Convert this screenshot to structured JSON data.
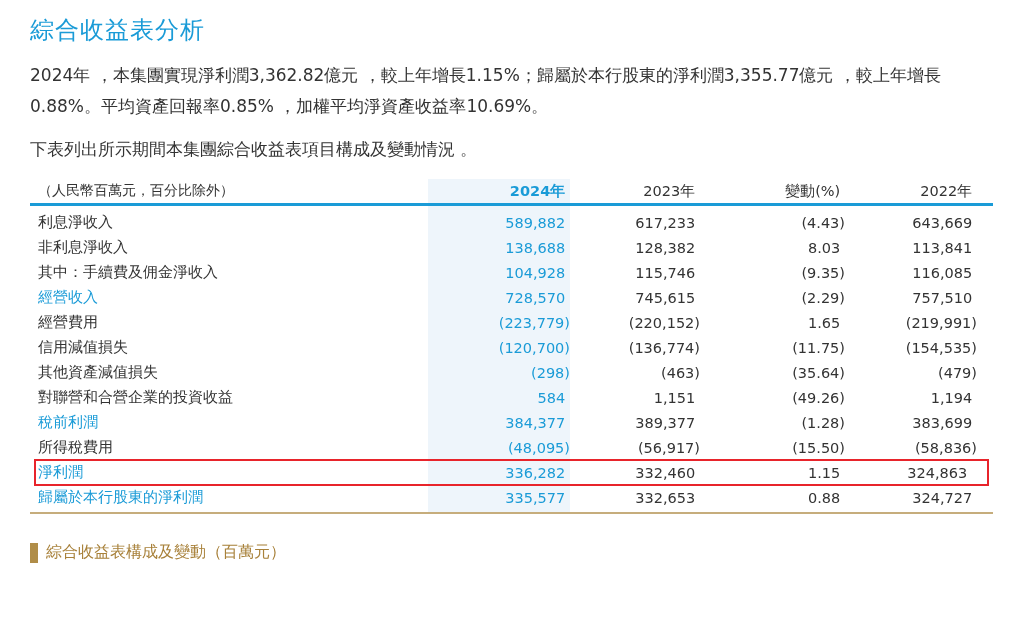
{
  "title": "綜合收益表分析",
  "paragraphs": [
    "2024年 ，本集團實現淨利潤3,362.82億元 ，較上年增長1.15%；歸屬於本行股東的淨利潤3,355.77億元 ，較上年增長0.88%。平均資產回報率0.85% ，加權平均淨資產收益率10.69%。",
    "下表列出所示期間本集團綜合收益表項目構成及變動情況 。"
  ],
  "table": {
    "columns": [
      {
        "label": "（人民幣百萬元，百分比除外）",
        "selected": false
      },
      {
        "label": "2024年",
        "selected": true
      },
      {
        "label": "2023年",
        "selected": false
      },
      {
        "label": "變動(%)",
        "selected": false
      },
      {
        "label": "2022年",
        "selected": false
      }
    ],
    "rows": [
      {
        "label": "利息淨收入",
        "values": [
          "589,882",
          "617,233",
          "(4.43)",
          "643,669"
        ],
        "emphasis": false,
        "highlighted": false
      },
      {
        "label": "非利息淨收入",
        "values": [
          "138,688",
          "128,382",
          "8.03",
          "113,841"
        ],
        "emphasis": false,
        "highlighted": false
      },
      {
        "label": "其中：手續費及佣金淨收入",
        "values": [
          "104,928",
          "115,746",
          "(9.35)",
          "116,085"
        ],
        "emphasis": false,
        "highlighted": false
      },
      {
        "label": "經營收入",
        "values": [
          "728,570",
          "745,615",
          "(2.29)",
          "757,510"
        ],
        "emphasis": true,
        "highlighted": false
      },
      {
        "label": "經營費用",
        "values": [
          "(223,779)",
          "(220,152)",
          "1.65",
          "(219,991)"
        ],
        "emphasis": false,
        "highlighted": false
      },
      {
        "label": "信用減值損失",
        "values": [
          "(120,700)",
          "(136,774)",
          "(11.75)",
          "(154,535)"
        ],
        "emphasis": false,
        "highlighted": false
      },
      {
        "label": "其他資產減值損失",
        "values": [
          "(298)",
          "(463)",
          "(35.64)",
          "(479)"
        ],
        "emphasis": false,
        "highlighted": false
      },
      {
        "label": "對聯營和合營企業的投資收益",
        "values": [
          "584",
          "1,151",
          "(49.26)",
          "1,194"
        ],
        "emphasis": false,
        "highlighted": false
      },
      {
        "label": "稅前利潤",
        "values": [
          "384,377",
          "389,377",
          "(1.28)",
          "383,699"
        ],
        "emphasis": true,
        "highlighted": false
      },
      {
        "label": "所得稅費用",
        "values": [
          "(48,095)",
          "(56,917)",
          "(15.50)",
          "(58,836)"
        ],
        "emphasis": false,
        "highlighted": false
      },
      {
        "label": "淨利潤",
        "values": [
          "336,282",
          "332,460",
          "1.15",
          "324,863"
        ],
        "emphasis": true,
        "highlighted": true
      },
      {
        "label": "歸屬於本行股東的淨利潤",
        "values": [
          "335,577",
          "332,653",
          "0.88",
          "324,727"
        ],
        "emphasis": true,
        "highlighted": false
      }
    ]
  },
  "chart_caption": "綜合收益表構成及變動（百萬元）"
}
